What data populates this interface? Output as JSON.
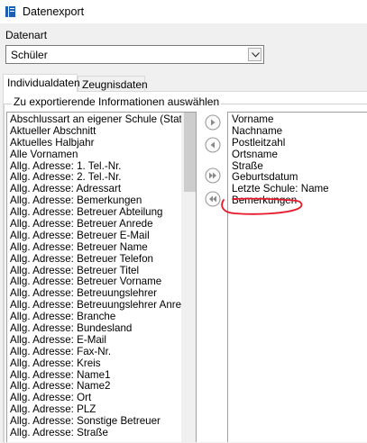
{
  "window": {
    "title": "Datenexport"
  },
  "datenart": {
    "label": "Datenart",
    "value": "Schüler"
  },
  "tabs": [
    {
      "label": "Individualdaten",
      "active": true
    },
    {
      "label": "Zeugnisdaten",
      "active": false
    }
  ],
  "group": {
    "legend": "Zu exportierende Informationen auswählen"
  },
  "available": {
    "items": [
      "Abschlussart an eigener Schule (Statistik)",
      "Aktueller Abschnitt",
      "Aktuelles Halbjahr",
      "Alle Vornamen",
      "Allg. Adresse: 1. Tel.-Nr.",
      "Allg. Adresse: 2. Tel.-Nr.",
      "Allg. Adresse: Adressart",
      "Allg. Adresse: Bemerkungen",
      "Allg. Adresse: Betreuer Abteilung",
      "Allg. Adresse: Betreuer Anrede",
      "Allg. Adresse: Betreuer E-Mail",
      "Allg. Adresse: Betreuer Name",
      "Allg. Adresse: Betreuer Telefon",
      "Allg. Adresse: Betreuer Titel",
      "Allg. Adresse: Betreuer Vorname",
      "Allg. Adresse: Betreuungslehrer",
      "Allg. Adresse: Betreuungslehrer Anrede",
      "Allg. Adresse: Branche",
      "Allg. Adresse: Bundesland",
      "Allg. Adresse: E-Mail",
      "Allg. Adresse: Fax-Nr.",
      "Allg. Adresse: Kreis",
      "Allg. Adresse: Name1",
      "Allg. Adresse: Name2",
      "Allg. Adresse: Ort",
      "Allg. Adresse: PLZ",
      "Allg. Adresse: Sonstige Betreuer",
      "Allg. Adresse: Straße"
    ]
  },
  "selected": {
    "items": [
      "Vorname",
      "Nachname",
      "Postleitzahl",
      "Ortsname",
      "Straße",
      "Geburtsdatum",
      "Letzte Schule: Name",
      "Bemerkungen"
    ]
  },
  "icons": {
    "app": "app-icon",
    "dropdown": "chevron-down-icon",
    "add": "arrow-right-icon",
    "remove": "arrow-left-icon",
    "add_all": "double-arrow-right-icon",
    "remove_all": "double-arrow-left-icon"
  },
  "colors": {
    "annotation": "#e8182a",
    "app_icon": "#1d5fb5"
  }
}
